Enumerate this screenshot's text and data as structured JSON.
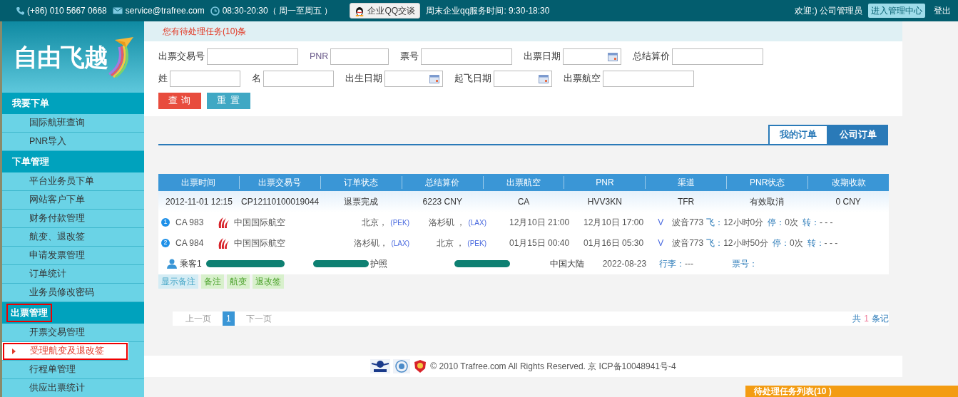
{
  "top_bar": {
    "phone": "(+86) 010 5667 0668",
    "email": "service@trafree.com",
    "hours": "08:30-20:30（ 周一至周五 ）",
    "qq_button": "企业QQ交谈",
    "weekend_hours": "周末企业qq服务时间: 9:30-18:30",
    "welcome": "欢迎:) 公司管理员",
    "admin_button": "进入管理中心",
    "logout": "登出"
  },
  "logo": {
    "text": "自由飞越"
  },
  "sidebar": [
    {
      "header": "我要下单",
      "outlined": false,
      "items": [
        {
          "label": "国际航班查询",
          "selected": false
        },
        {
          "label": "PNR导入",
          "selected": false
        }
      ]
    },
    {
      "header": "下单管理",
      "outlined": false,
      "items": [
        {
          "label": "平台业务员下单",
          "selected": false
        },
        {
          "label": "网站客户下单",
          "selected": false
        },
        {
          "label": "财务付款管理",
          "selected": false
        },
        {
          "label": "航变、退改签",
          "selected": false
        },
        {
          "label": "申请发票管理",
          "selected": false
        },
        {
          "label": "订单统计",
          "selected": false
        },
        {
          "label": "业务员修改密码",
          "selected": false
        }
      ]
    },
    {
      "header": "出票管理",
      "outlined": true,
      "items": [
        {
          "label": "开票交易管理",
          "selected": false
        },
        {
          "label": "受理航变及退改签",
          "selected": true
        },
        {
          "label": "行程单管理",
          "selected": false
        },
        {
          "label": "供应出票统计",
          "selected": false
        }
      ]
    }
  ],
  "notice": "您有待处理任务(10)条",
  "search_form": {
    "rows": [
      [
        {
          "label": "出票交易号",
          "kind": "text"
        },
        {
          "label": "PNR",
          "kind": "short"
        },
        {
          "label": "票号",
          "kind": "text"
        },
        {
          "label": "出票日期",
          "kind": "date"
        },
        {
          "label": "总结算价",
          "kind": "text"
        }
      ],
      [
        {
          "label": "姓",
          "kind": "short"
        },
        {
          "label": "名",
          "kind": "short"
        },
        {
          "label": "出生日期",
          "kind": "date"
        },
        {
          "label": "起飞日期",
          "kind": "date"
        },
        {
          "label": "出票航空",
          "kind": "text"
        }
      ]
    ],
    "buttons": [
      {
        "label": "查 询",
        "kind": "danger"
      },
      {
        "label": "重 置",
        "kind": "info"
      }
    ]
  },
  "tabs": [
    {
      "label": "我的订单",
      "selected": true
    },
    {
      "label": "公司订单",
      "selected": false
    }
  ],
  "table": {
    "columns": [
      "出票时间",
      "出票交易号",
      "订单状态",
      "总结算价",
      "出票航空",
      "PNR",
      "渠道",
      "PNR状态",
      "改期收款"
    ],
    "rows": [
      {
        "cells": [
          "2012-11-01 12:15",
          "CP12110100019044",
          "退票完成",
          "6223 CNY",
          "CA",
          "HVV3KN",
          "TFR",
          "有效取消",
          "0 CNY"
        ],
        "segments": [
          {
            "number": "1",
            "flight": "CA 983",
            "airline": "中国国际航空",
            "from_city": "北京，",
            "from_code": "(PEK)",
            "to_city": "洛杉矶 ，",
            "to_code": "(LAX)",
            "depart": "12月10日 21:00",
            "arrive": "12月10日 17:00",
            "cabin": "V",
            "aircraft": "波音773",
            "fly_label": "飞：",
            "fly_time": "12小时0分",
            "stop_label": "停：",
            "stops": "0次",
            "transfer_label": "转：",
            "transfer": "- - -"
          },
          {
            "number": "2",
            "flight": "CA 984",
            "airline": "中国国际航空",
            "from_city": "洛杉矶，",
            "from_code": "(LAX)",
            "to_city": "北京 ，",
            "to_code": "(PEK)",
            "depart": "01月15日 00:40",
            "arrive": "01月16日 05:30",
            "cabin": "V",
            "aircraft": "波音773",
            "fly_label": "飞：",
            "fly_time": "12小时50分",
            "stop_label": "停：",
            "stops": "0次",
            "transfer_label": "转：",
            "transfer": "- - -"
          }
        ],
        "passenger": {
          "name": "乘客1",
          "document": "护照",
          "nationality": "中国大陆",
          "date": "2022-08-23",
          "baggage_label": "行李：",
          "baggage": "---",
          "ticket_label": "票号："
        },
        "actions": [
          {
            "label": "显示备注",
            "kind": "info"
          },
          {
            "label": "备注",
            "kind": "success"
          },
          {
            "label": "航变",
            "kind": "success"
          },
          {
            "label": "退改签",
            "kind": "success"
          }
        ]
      }
    ]
  },
  "pagination": {
    "prev": "上一页",
    "pages": [
      {
        "label": "1",
        "selected": true
      }
    ],
    "next": "下一页",
    "total_prefix": "共",
    "total_count": "1",
    "total_suffix": "条记"
  },
  "footer": "© 2010 Trafree.com All Rights Reserved. 京 ICP备10048941号-4",
  "task_panel": {
    "title": "待处理任务列表(10 )"
  }
}
